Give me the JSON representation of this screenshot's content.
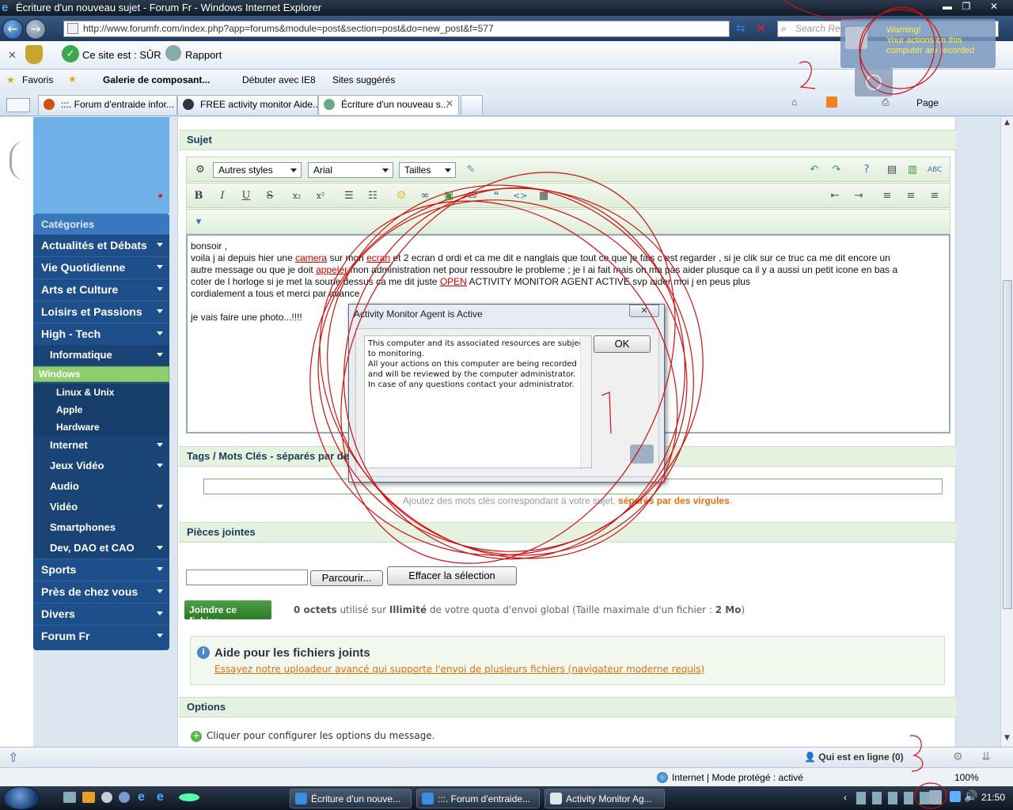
{
  "window": {
    "title": "Écriture d'un nouveau sujet - Forum Fr - Windows Internet Explorer",
    "minimize": "▬",
    "maximize": "❐",
    "close": "✕"
  },
  "address": {
    "url": "http://www.forumfr.com/index.php?app=forums&module=post&section=post&do=new_post&f=577",
    "search_placeholder": "Search Results"
  },
  "security": {
    "site_status": "Ce site est : SÛR",
    "report": "Rapport"
  },
  "favorites": {
    "label": "Favoris",
    "items": [
      "Galerie de composant...",
      "Débuter avec IE8",
      "Sites suggérés"
    ]
  },
  "tabs": [
    {
      "label": ":::. Forum d'entraide infor...",
      "color": "#d05010"
    },
    {
      "label": "FREE activity monitor Aide...",
      "color": "#334"
    },
    {
      "label": "Écriture d'un nouveau s...",
      "color": "#6a8"
    }
  ],
  "command_bar": {
    "page": "Page"
  },
  "sidebar": {
    "header": "Catégories",
    "items": [
      "Actualités et Débats",
      "Vie Quotidienne",
      "Arts et Culture",
      "Loisirs et Passions",
      "High - Tech"
    ],
    "sub_informatique": "Informatique",
    "subsub": [
      "Windows",
      "Linux & Unix",
      "Apple",
      "Hardware"
    ],
    "sub_items": [
      "Internet",
      "Jeux Vidéo",
      "Audio",
      "Vidéo",
      "Smartphones",
      "Dev, DAO et CAO"
    ],
    "bottom_items": [
      "Sports",
      "Près de chez vous",
      "Divers",
      "Forum Fr"
    ]
  },
  "form": {
    "sujet_header": "Sujet",
    "styles_select": "Autres styles",
    "font_select": "Arial",
    "size_select": "Tailles",
    "post_lines": {
      "l1": "bonsoir ,",
      "l2a": "voila j ai depuis hier une ",
      "l2b": "camera",
      "l2c": " sur mon ",
      "l2d": "ecran",
      "l2e": " et 2 ecran d ordi et ca me dit e nanglais que tout ce que je fais c est regarder , si je clik sur ce truc ca me dit encore un",
      "l3a": "autre message ou que je doit ",
      "l3b": "appeler",
      "l3c": " mon administration net pour ressoubre le probleme ; je l ai fait mais on ma pas aider plusque ca il y a aussi un petit icone en bas a",
      "l4a": "coter de l horloge si je met la sourie dessus ca me dit juste ",
      "l4b": "OPEN",
      "l4c": " ACTIVITY MONITOR AGENT ACTIVE svp aider moi j en peus plus",
      "l5": "cordialement a tous et merci par avance",
      "l6": "je vais faire une photo...!!!!"
    },
    "tags_header": "Tags / Mots Clés - séparés par de",
    "tags_help": "Ajoutez des mots clés correspondant à votre sujet,",
    "tags_help_bold": "séparés par des virgules",
    "tags_help_end": ".",
    "attach_header": "Pièces jointes",
    "browse_button": "Parcourir...",
    "clear_button": "Effacer la sélection",
    "join_button": "Joindre ce fichier",
    "quota_used": "0 octets",
    "quota_text1": " utilisé sur ",
    "quota_limit": "Illimité",
    "quota_text2": " de votre quota d'envoi global (Taille maximale d'un fichier : ",
    "quota_max": "2 Mo",
    "quota_text3": ")",
    "help_title": "Aide pour les fichiers joints",
    "help_link": "Essayez notre uploadeur avancé qui supporte l'envoi de plusieurs fichiers (navigateur moderne requis)",
    "options_header": "Options",
    "options_text": "Cliquer pour configurer les options du message."
  },
  "bottom": {
    "online": "Qui est en ligne (0)"
  },
  "status": {
    "zone": "Internet | Mode protégé : activé",
    "zoom": "100%"
  },
  "taskbar": {
    "tasks": [
      {
        "label": "Écriture d'un nouve...",
        "color": "#3a8fe0"
      },
      {
        "label": ":::. Forum d'entraide...",
        "color": "#3a8fe0"
      },
      {
        "label": "Activity Monitor Ag...",
        "color": "#dfe6ee"
      }
    ],
    "clock": "21:50"
  },
  "dialog": {
    "title": "Activity Monitor Agent is Active",
    "message": "This computer and its associated resources are subject to monitoring.\nAll your actions on this computer are being recorded and will be reviewed by the computer administrator.\nIn case of any questions contact your administrator.",
    "ok": "OK",
    "close": "✕"
  },
  "warning": {
    "title": "Warning!",
    "text": "Your actions on this computer are recorded"
  }
}
